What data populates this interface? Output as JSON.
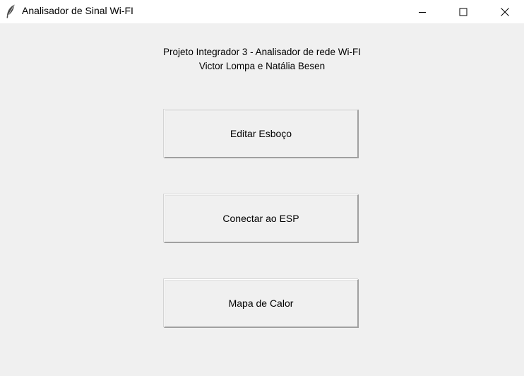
{
  "window": {
    "title": "Analisador de Sinal Wi-FI",
    "icon": "feather-icon",
    "controls": [
      "minimize-icon",
      "maximize-icon",
      "close-icon"
    ]
  },
  "header": {
    "line1": "Projeto Integrador 3 - Analisador de rede Wi-FI",
    "line2": "Victor Lompa e Natália Besen"
  },
  "buttons": {
    "edit_sketch": "Editar Esboço",
    "connect_esp": "Conectar ao ESP",
    "heat_map": "Mapa de Calor"
  },
  "colors": {
    "background": "#f0f0f0",
    "titlebar": "#ffffff",
    "text": "#000000"
  }
}
